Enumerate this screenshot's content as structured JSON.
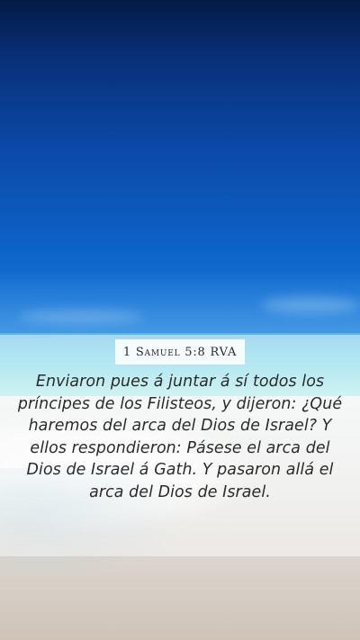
{
  "reference": "1 Samuel 5:8 RVA",
  "verse": "Enviaron pues á juntar á sí todos los príncipes de los Filisteos, y dijeron: ¿Qué haremos del arca del Dios de Israel? Y ellos respondieron: Pásese el arca del Dios de Israel á Gath. Y pasaron allá el arca del Dios de Israel.",
  "colors": {
    "sky_top": "#041a44",
    "sky_bottom": "#1a7fdc",
    "sea": "#6fd0e8",
    "sand": "#dcd6cf",
    "text": "#2b2b2b"
  }
}
